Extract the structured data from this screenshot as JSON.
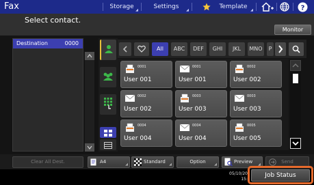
{
  "app": {
    "title": "Fax"
  },
  "top_tabs": [
    {
      "label": "Storage"
    },
    {
      "label": "Settings"
    },
    {
      "label": "Template"
    }
  ],
  "header": {
    "instruction": "Select contact.",
    "monitor_label": "Monitor"
  },
  "destination": {
    "label": "Destination",
    "count": "0000"
  },
  "filter": {
    "tabs": [
      "All",
      "ABC",
      "DEF",
      "GHI",
      "JKL",
      "MNO",
      "P"
    ],
    "active": "All"
  },
  "contacts": [
    {
      "number": "0001",
      "name": "User 001",
      "type": "fax"
    },
    {
      "number": "0001",
      "name": "User 001",
      "type": "email"
    },
    {
      "number": "0002",
      "name": "User 002",
      "type": "fax"
    },
    {
      "number": "0002",
      "name": "User 002",
      "type": "email"
    },
    {
      "number": "0003",
      "name": "User 003",
      "type": "fax"
    },
    {
      "number": "0003",
      "name": "User 003",
      "type": "email"
    },
    {
      "number": "0004",
      "name": "User 004",
      "type": "fax"
    },
    {
      "number": "0004",
      "name": "User 004",
      "type": "email"
    },
    {
      "number": "0005",
      "name": "User 005",
      "type": "fax"
    }
  ],
  "bottom": {
    "clear_all": "Clear All Dest.",
    "paper_size": "A4",
    "resolution": "Standard",
    "option": "Option",
    "preview": "Preview",
    "send": "Send"
  },
  "footer": {
    "date": "05/10/20",
    "time": "15:",
    "job_status": "Job Status"
  },
  "colors": {
    "top_bar": "#1d2a8a",
    "accent_blue": "#3c3fb0",
    "highlight": "#e66a2c",
    "contact_green": "#3db84a"
  },
  "icons": [
    "home-icon",
    "globe-icon",
    "help-icon",
    "star-icon",
    "search-icon",
    "heart-icon",
    "single-contact-icon",
    "group-contact-icon",
    "keypad-icon",
    "grid-view-icon",
    "list-view-icon",
    "fax-icon",
    "email-icon"
  ]
}
